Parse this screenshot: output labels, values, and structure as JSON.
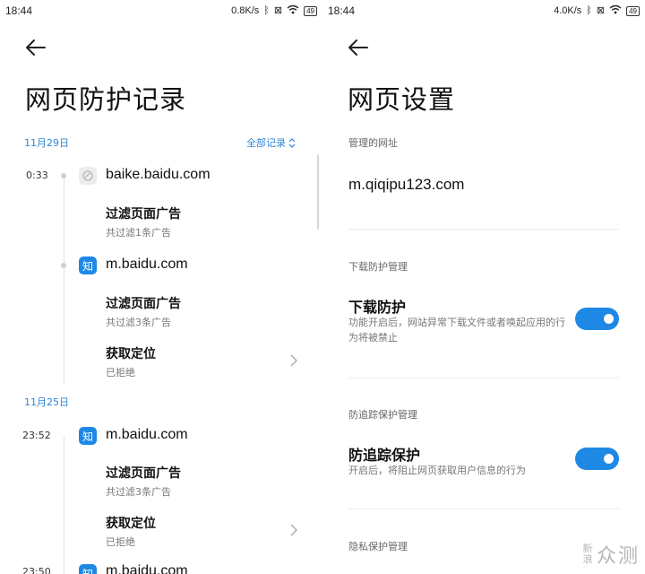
{
  "left": {
    "status": {
      "time": "18:44",
      "speed": "0.8K/s",
      "battery": "49"
    },
    "title": "网页防护记录",
    "filter_label": "全部记录",
    "groups": [
      {
        "date": "11月29日",
        "entries": [
          {
            "time": "0:33",
            "icon": "grey-site-icon",
            "site": "baike.baidu.com",
            "events": [
              {
                "title": "过滤页面广告",
                "sub": "共过滤1条广告"
              }
            ]
          },
          {
            "time": "",
            "icon": "zhi",
            "icon_text": "知",
            "site": "m.baidu.com",
            "events": [
              {
                "title": "过滤页面广告",
                "sub": "共过滤3条广告"
              },
              {
                "title": "获取定位",
                "sub": "已拒绝"
              }
            ]
          }
        ]
      },
      {
        "date": "11月25日",
        "entries": [
          {
            "time": "23:52",
            "icon": "zhi",
            "icon_text": "知",
            "site": "m.baidu.com",
            "events": [
              {
                "title": "过滤页面广告",
                "sub": "共过滤3条广告"
              },
              {
                "title": "获取定位",
                "sub": "已拒绝"
              }
            ]
          },
          {
            "time": "23:50",
            "icon": "zhi",
            "icon_text": "知",
            "site": "m.baidu.com",
            "events": []
          }
        ]
      }
    ]
  },
  "right": {
    "status": {
      "time": "18:44",
      "speed": "4.0K/s",
      "battery": "49"
    },
    "title": "网页设置",
    "managed_url_head": "管理的网址",
    "managed_url": "m.qiqipu123.com",
    "download": {
      "head": "下载防护管理",
      "title": "下载防护",
      "desc": "功能开启后，网站异常下载文件或者唤起应用的行为将被禁止",
      "enabled": true
    },
    "tracking": {
      "head": "防追踪保护管理",
      "title": "防追踪保护",
      "desc": "开启后，将阻止网页获取用户信息的行为",
      "enabled": true
    },
    "privacy_head": "隐私保护管理"
  },
  "watermark": {
    "small": "新浪",
    "big": "众测"
  },
  "colors": {
    "accent": "#1e88e5",
    "link": "#2f86d6"
  }
}
